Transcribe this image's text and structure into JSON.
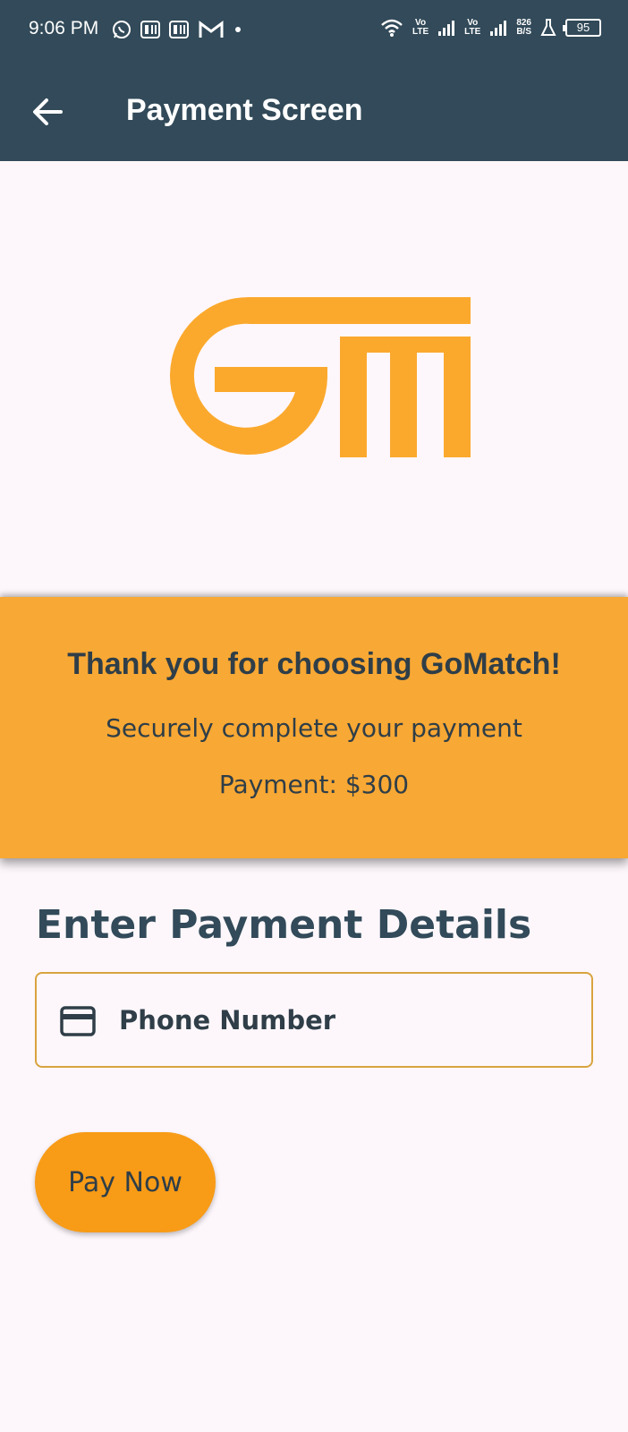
{
  "status_bar": {
    "time": "9:06 PM",
    "network_speed_top": "826",
    "network_speed_bottom": "B/S",
    "battery": "95",
    "volte_label_1_top": "Vo",
    "volte_label_1_bottom": "LTE",
    "volte_label_2_top": "Vo",
    "volte_label_2_bottom": "LTE",
    "icons": [
      "whatsapp-icon",
      "paytm-icon",
      "paytm-icon",
      "gmail-icon",
      "dot-icon",
      "wifi-icon",
      "signal-icon",
      "signal-icon",
      "lab-icon",
      "battery-icon"
    ]
  },
  "app_bar": {
    "title": "Payment Screen",
    "back_icon": "arrow-left-icon"
  },
  "logo": {
    "name": "gomatch-logo",
    "color": "#fba92d"
  },
  "banner": {
    "title": "Thank you for choosing GoMatch!",
    "subtitle": "Securely complete your payment",
    "payment": "Payment: $300",
    "background": "#f8a834"
  },
  "form": {
    "heading": "Enter Payment Details",
    "phone_placeholder": "Phone Number",
    "phone_value": "",
    "field_icon": "credit-card-icon",
    "pay_button": "Pay Now"
  },
  "colors": {
    "primary_dark": "#324a59",
    "accent": "#f89b16",
    "page_background": "#fdf7fb"
  }
}
